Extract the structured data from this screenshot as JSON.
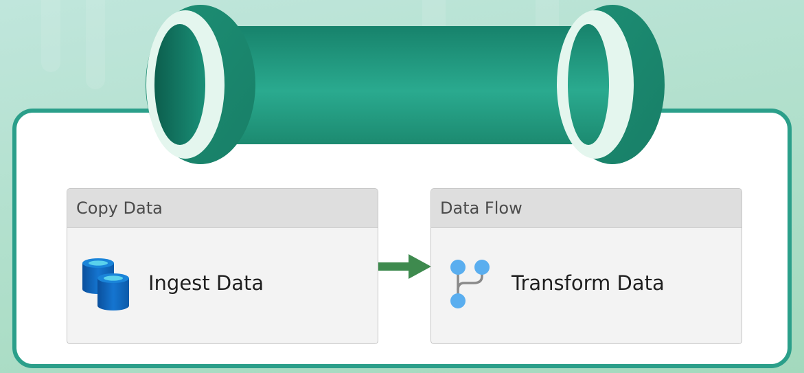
{
  "activities": [
    {
      "type_label": "Copy Data",
      "name": "Ingest Data",
      "icon": "database-icon"
    },
    {
      "type_label": "Data Flow",
      "name": "Transform Data",
      "icon": "data-flow-icon"
    }
  ],
  "colors": {
    "accent": "#2b9f8a",
    "arrow": "#3e8a4e",
    "icon_blue": "#0f6cbd",
    "icon_flow": "#5aaeef"
  }
}
